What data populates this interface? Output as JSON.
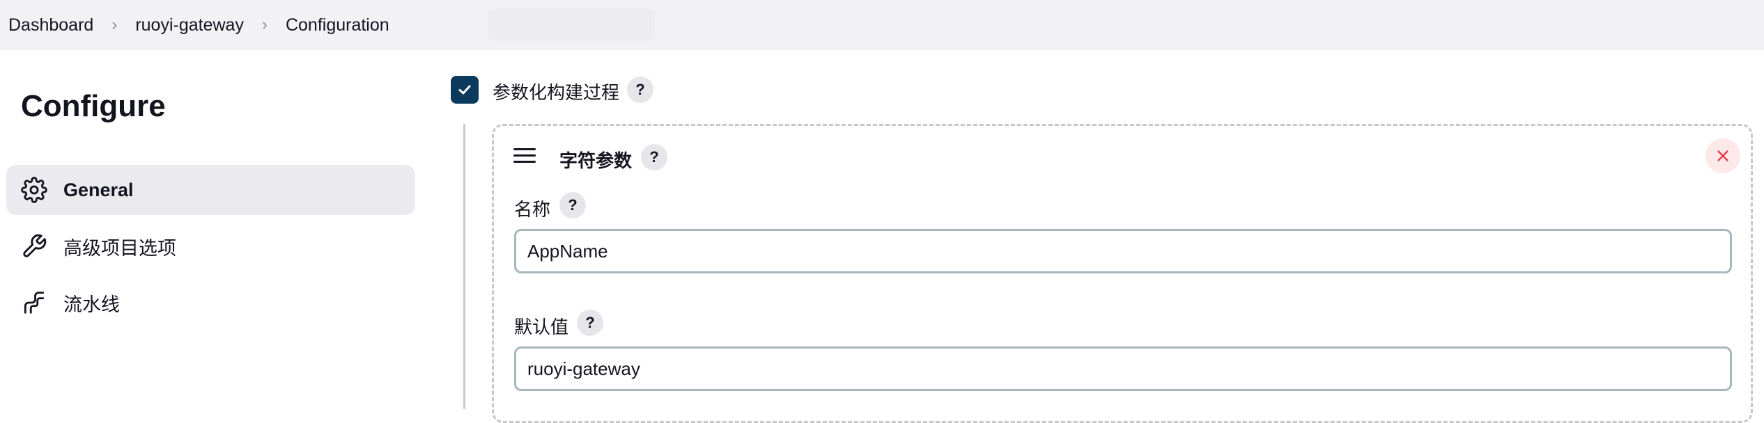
{
  "breadcrumb": {
    "items": [
      "Dashboard",
      "ruoyi-gateway",
      "Configuration"
    ],
    "separator": "›"
  },
  "sidebar": {
    "title": "Configure",
    "items": [
      {
        "label": "General",
        "icon": "gear-icon",
        "active": true
      },
      {
        "label": "高级项目选项",
        "icon": "wrench-icon",
        "active": false
      },
      {
        "label": "流水线",
        "icon": "pipeline-icon",
        "active": false
      }
    ]
  },
  "main": {
    "parameterized": {
      "label": "参数化构建过程",
      "checked": true,
      "help": "?"
    },
    "parameter": {
      "title": "字符参数",
      "help": "?",
      "name_label": "名称",
      "name_help": "?",
      "name_value": "AppName",
      "default_label": "默认值",
      "default_help": "?",
      "default_value": "ruoyi-gateway"
    }
  },
  "colors": {
    "topbar_bg": "#f2f2f5",
    "checkbox_bg": "#0b3a5c",
    "active_nav_bg": "#ebebef",
    "close_bg": "#fde8ea",
    "close_icon": "#e5303f",
    "input_border": "#a7b7bc"
  }
}
